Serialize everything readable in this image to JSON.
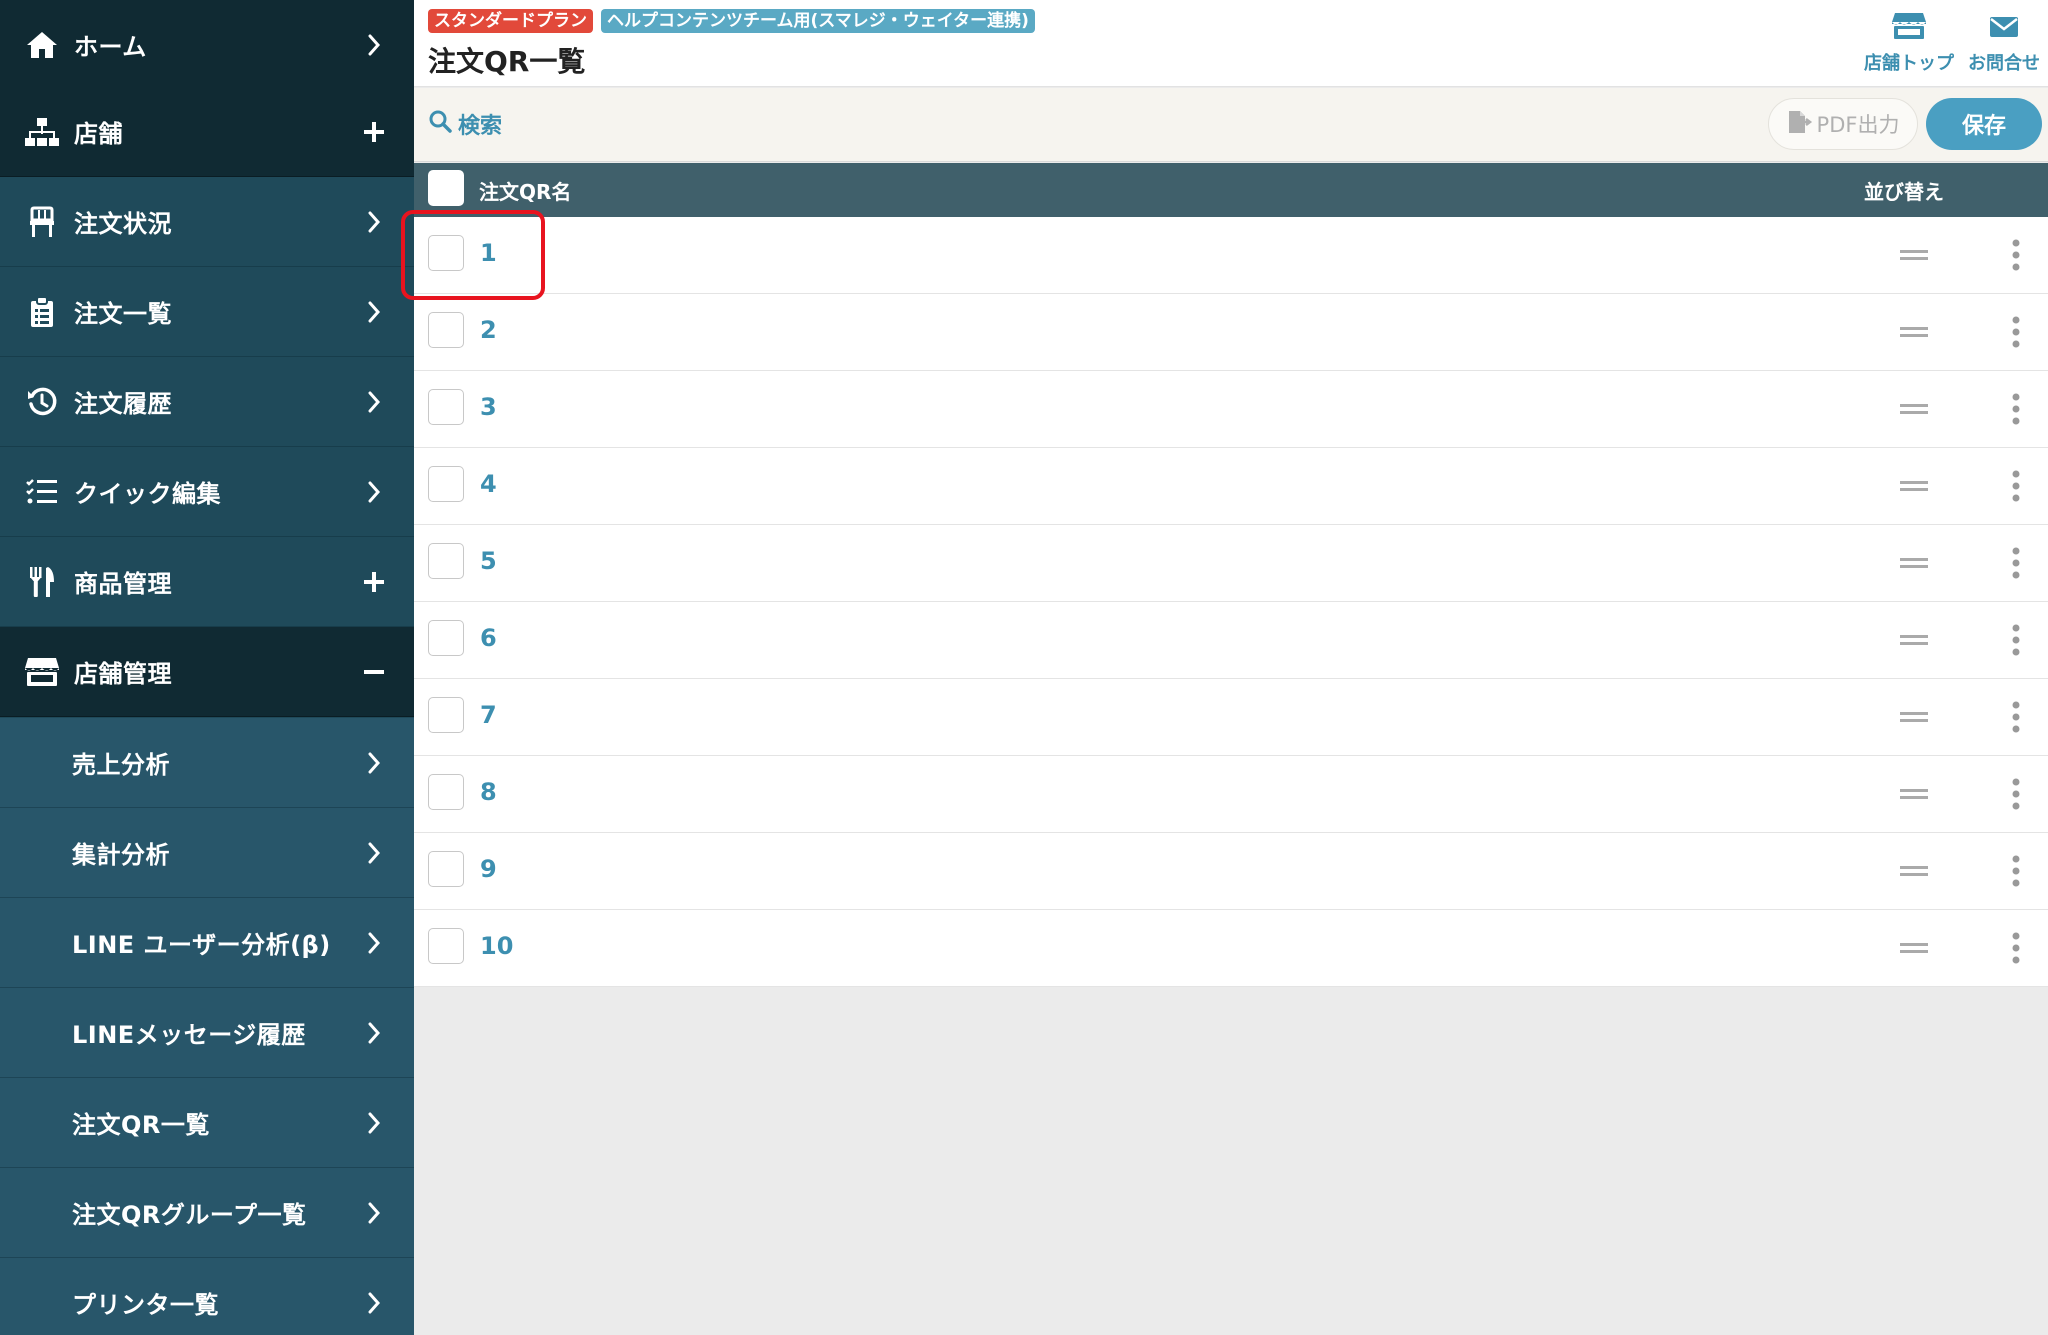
{
  "sidebar": {
    "items": [
      {
        "label": "ホーム",
        "icon": "home-icon",
        "trail": "chevron-right-icon"
      },
      {
        "label": "店舗",
        "icon": "sitemap-icon",
        "trail": "plus-icon"
      },
      {
        "label": "注文状況",
        "icon": "chair-icon",
        "trail": "chevron-right-icon"
      },
      {
        "label": "注文一覧",
        "icon": "clipboard-icon",
        "trail": "chevron-right-icon"
      },
      {
        "label": "注文履歴",
        "icon": "history-icon",
        "trail": "chevron-right-icon"
      },
      {
        "label": "クイック編集",
        "icon": "list-check-icon",
        "trail": "chevron-right-icon"
      },
      {
        "label": "商品管理",
        "icon": "utensils-icon",
        "trail": "plus-icon"
      },
      {
        "label": "店舗管理",
        "icon": "store-icon",
        "trail": "minus-icon"
      },
      {
        "label": "売上分析",
        "trail": "chevron-right-icon"
      },
      {
        "label": "集計分析",
        "trail": "chevron-right-icon"
      },
      {
        "label": "LINE ユーザー分析(β)",
        "trail": "chevron-right-icon"
      },
      {
        "label": "LINEメッセージ履歴",
        "trail": "chevron-right-icon"
      },
      {
        "label": "注文QR一覧",
        "trail": "chevron-right-icon"
      },
      {
        "label": "注文QRグループ一覧",
        "trail": "chevron-right-icon"
      },
      {
        "label": "プリンタ一覧",
        "trail": "chevron-right-icon"
      }
    ]
  },
  "header": {
    "plan_badge": "スタンダードプラン",
    "store_badge": "ヘルプコンテンツチーム用(スマレジ・ウェイター連携)",
    "title": "注文QR一覧",
    "store_top": "店舗トップ",
    "contact": "お問合せ"
  },
  "toolbar": {
    "search": "検索",
    "pdf": "PDF出力",
    "save": "保存"
  },
  "table": {
    "col_name": "注文QR名",
    "col_sort": "並び替え",
    "rows": [
      "1",
      "2",
      "3",
      "4",
      "5",
      "6",
      "7",
      "8",
      "9",
      "10"
    ]
  },
  "colors": {
    "sidebar_dark": "#102a33",
    "sidebar": "#1f4a5a",
    "sidebar_sub": "#28566a",
    "accent": "#3d8fb0",
    "save_button": "#4a9fc2",
    "plan_badge": "#e2493a",
    "table_header": "#40606b",
    "highlight": "#e8141f"
  }
}
